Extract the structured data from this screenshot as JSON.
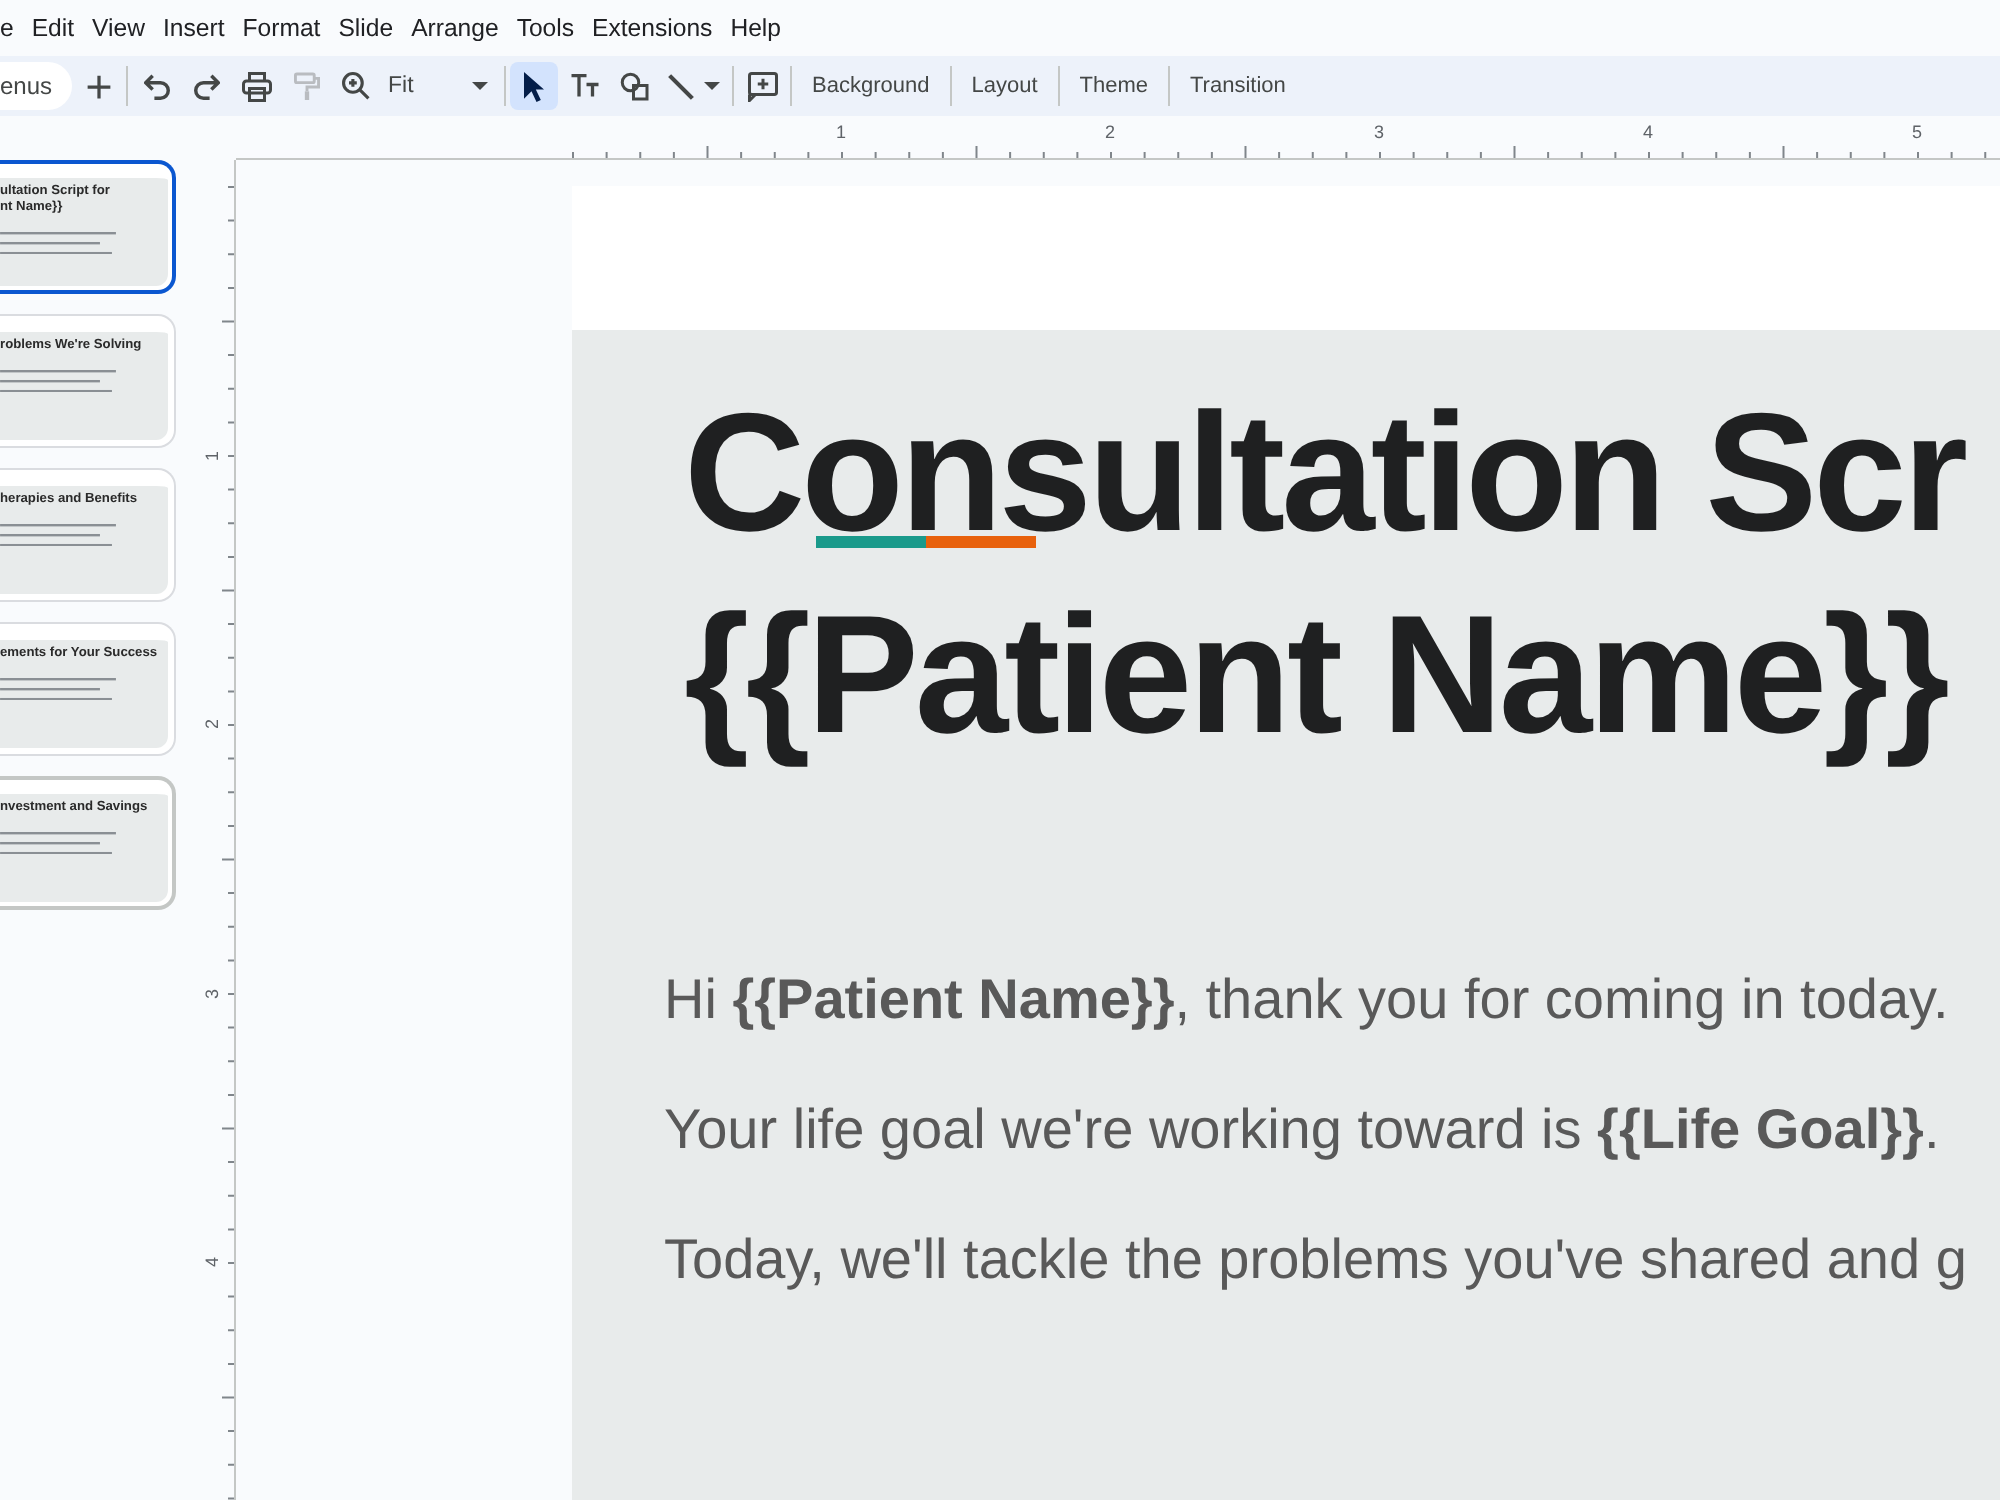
{
  "menu_bar": [
    "e",
    "Edit",
    "View",
    "Insert",
    "Format",
    "Slide",
    "Arrange",
    "Tools",
    "Extensions",
    "Help"
  ],
  "toolbar": {
    "groups": [
      [
        {
          "kind": "search",
          "placeholder": "enus"
        },
        {
          "kind": "icon",
          "selected": false,
          "disabled": false
        }
      ],
      [
        {
          "kind": "icon",
          "selected": false,
          "disabled": false
        },
        {
          "kind": "icon",
          "selected": false,
          "disabled": false
        },
        {
          "kind": "icon",
          "selected": false,
          "disabled": false
        },
        {
          "kind": "icon",
          "selected": false,
          "disabled": true
        },
        {
          "kind": "icon",
          "selected": false,
          "disabled": false
        },
        {
          "kind": "dropdown",
          "value": "Fit"
        }
      ],
      [
        {
          "kind": "icon",
          "selected": true,
          "disabled": false
        },
        {
          "kind": "icon",
          "selected": false,
          "disabled": false
        },
        {
          "kind": "icon",
          "selected": false,
          "disabled": false
        },
        {
          "kind": "icon-dropdown",
          "selected": false,
          "disabled": false
        }
      ],
      [
        {
          "kind": "icon",
          "selected": false,
          "disabled": false
        }
      ],
      [
        {
          "kind": "text",
          "label": "Background"
        }
      ],
      [
        {
          "kind": "text",
          "label": "Layout"
        }
      ],
      [
        {
          "kind": "text",
          "label": "Theme"
        }
      ],
      [
        {
          "kind": "text",
          "label": "Transition"
        }
      ]
    ]
  },
  "slides": [
    {
      "title_lines": [
        "ultation Script for",
        "nt Name}}"
      ],
      "selected": true,
      "hovered": false
    },
    {
      "title_lines": [
        "roblems We're Solving"
      ],
      "selected": false,
      "hovered": false
    },
    {
      "title_lines": [
        "herapies and Benefits"
      ],
      "selected": false,
      "hovered": false
    },
    {
      "title_lines": [
        "ements for Your Success"
      ],
      "selected": false,
      "hovered": false
    },
    {
      "title_lines": [
        "nvestment and Savings"
      ],
      "selected": false,
      "hovered": true
    }
  ],
  "rulers": {
    "horizontal": [
      "1",
      "2",
      "3",
      "4",
      "5"
    ],
    "vertical": [
      "1",
      "2",
      "3",
      "4"
    ]
  },
  "slide": {
    "title_lines": [
      "Consultation Scr",
      "{{Patient Name}}"
    ],
    "accent_marks": [
      {
        "color": "#1a9a8b"
      },
      {
        "color": "#e8610c"
      }
    ],
    "paragraphs": [
      "Hi **{{Patient Name}}**, thank you for coming in today.",
      "Your life goal we're working toward is **{{Life Goal}}**.",
      "Today, we'll tackle the problems you've shared and g"
    ]
  }
}
